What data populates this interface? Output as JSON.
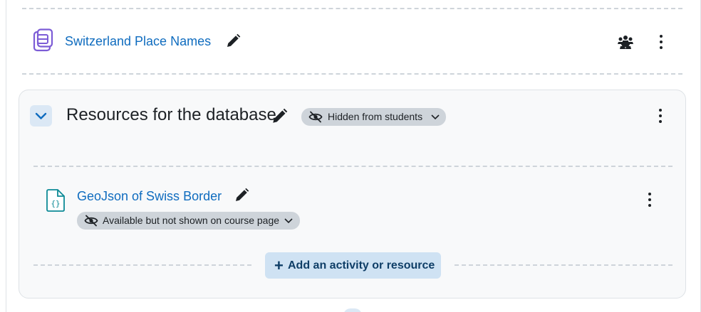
{
  "activity": {
    "title": "Switzerland Place Names",
    "icon": "database-icon",
    "edit_icon": "pencil-icon",
    "groups_icon": "groups-icon",
    "menu_icon": "kebab-icon"
  },
  "section": {
    "title": "Resources for the database",
    "visibility_badge": "Hidden from students",
    "collapse_icon": "chevron-down-icon",
    "menu_icon": "kebab-icon"
  },
  "resource": {
    "title": "GeoJson of Swiss Border",
    "icon": "file-code-icon",
    "visibility_badge": "Available but not shown on course page"
  },
  "add_activity": {
    "label": "Add an activity or resource",
    "icon": "plus"
  },
  "colors": {
    "link": "#0f6cbf",
    "badge_bg": "#ced4da",
    "add_button_bg": "#cfe2f3",
    "icon_purple": "#7c5cd6",
    "icon_teal": "#0d8a96"
  }
}
